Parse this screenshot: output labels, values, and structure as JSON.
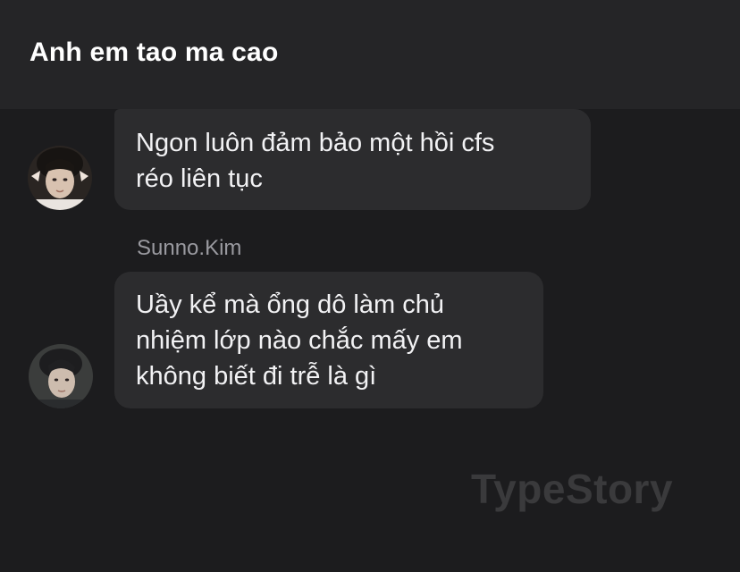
{
  "header": {
    "title": "Anh em tao ma cao"
  },
  "messages": [
    {
      "sender": "",
      "text": "Ngon luôn đảm bảo một hồi cfs\nréo liên tục"
    },
    {
      "sender": "Sunno.Kim",
      "text": "Uầy kể mà ổng dô làm chủ\nnhiệm lớp nào chắc mấy em\nkhông biết đi trễ là gì"
    }
  ],
  "watermark": "TypeStory",
  "colors": {
    "background": "#1c1c1e",
    "header": "#252527",
    "bubble": "#2c2c2e",
    "text": "#f2f2f4",
    "sender": "#9a9aa0"
  }
}
